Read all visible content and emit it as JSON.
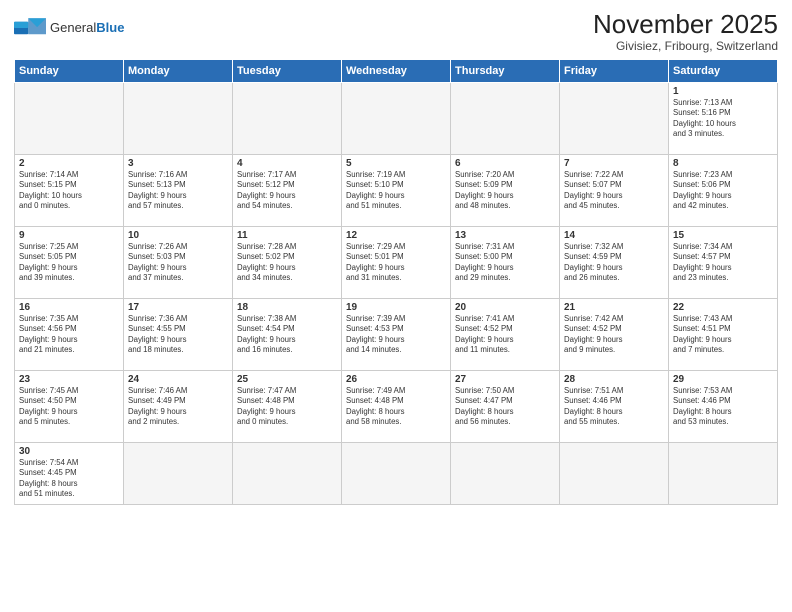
{
  "header": {
    "logo_general": "General",
    "logo_blue": "Blue",
    "month_year": "November 2025",
    "location": "Givisiez, Fribourg, Switzerland"
  },
  "days_of_week": [
    "Sunday",
    "Monday",
    "Tuesday",
    "Wednesday",
    "Thursday",
    "Friday",
    "Saturday"
  ],
  "weeks": [
    [
      {
        "day": "",
        "info": "",
        "empty": true
      },
      {
        "day": "",
        "info": "",
        "empty": true
      },
      {
        "day": "",
        "info": "",
        "empty": true
      },
      {
        "day": "",
        "info": "",
        "empty": true
      },
      {
        "day": "",
        "info": "",
        "empty": true
      },
      {
        "day": "",
        "info": "",
        "empty": true
      },
      {
        "day": "1",
        "info": "Sunrise: 7:13 AM\nSunset: 5:16 PM\nDaylight: 10 hours\nand 3 minutes.",
        "empty": false
      }
    ],
    [
      {
        "day": "2",
        "info": "Sunrise: 7:14 AM\nSunset: 5:15 PM\nDaylight: 10 hours\nand 0 minutes.",
        "empty": false
      },
      {
        "day": "3",
        "info": "Sunrise: 7:16 AM\nSunset: 5:13 PM\nDaylight: 9 hours\nand 57 minutes.",
        "empty": false
      },
      {
        "day": "4",
        "info": "Sunrise: 7:17 AM\nSunset: 5:12 PM\nDaylight: 9 hours\nand 54 minutes.",
        "empty": false
      },
      {
        "day": "5",
        "info": "Sunrise: 7:19 AM\nSunset: 5:10 PM\nDaylight: 9 hours\nand 51 minutes.",
        "empty": false
      },
      {
        "day": "6",
        "info": "Sunrise: 7:20 AM\nSunset: 5:09 PM\nDaylight: 9 hours\nand 48 minutes.",
        "empty": false
      },
      {
        "day": "7",
        "info": "Sunrise: 7:22 AM\nSunset: 5:07 PM\nDaylight: 9 hours\nand 45 minutes.",
        "empty": false
      },
      {
        "day": "8",
        "info": "Sunrise: 7:23 AM\nSunset: 5:06 PM\nDaylight: 9 hours\nand 42 minutes.",
        "empty": false
      }
    ],
    [
      {
        "day": "9",
        "info": "Sunrise: 7:25 AM\nSunset: 5:05 PM\nDaylight: 9 hours\nand 39 minutes.",
        "empty": false
      },
      {
        "day": "10",
        "info": "Sunrise: 7:26 AM\nSunset: 5:03 PM\nDaylight: 9 hours\nand 37 minutes.",
        "empty": false
      },
      {
        "day": "11",
        "info": "Sunrise: 7:28 AM\nSunset: 5:02 PM\nDaylight: 9 hours\nand 34 minutes.",
        "empty": false
      },
      {
        "day": "12",
        "info": "Sunrise: 7:29 AM\nSunset: 5:01 PM\nDaylight: 9 hours\nand 31 minutes.",
        "empty": false
      },
      {
        "day": "13",
        "info": "Sunrise: 7:31 AM\nSunset: 5:00 PM\nDaylight: 9 hours\nand 29 minutes.",
        "empty": false
      },
      {
        "day": "14",
        "info": "Sunrise: 7:32 AM\nSunset: 4:59 PM\nDaylight: 9 hours\nand 26 minutes.",
        "empty": false
      },
      {
        "day": "15",
        "info": "Sunrise: 7:34 AM\nSunset: 4:57 PM\nDaylight: 9 hours\nand 23 minutes.",
        "empty": false
      }
    ],
    [
      {
        "day": "16",
        "info": "Sunrise: 7:35 AM\nSunset: 4:56 PM\nDaylight: 9 hours\nand 21 minutes.",
        "empty": false
      },
      {
        "day": "17",
        "info": "Sunrise: 7:36 AM\nSunset: 4:55 PM\nDaylight: 9 hours\nand 18 minutes.",
        "empty": false
      },
      {
        "day": "18",
        "info": "Sunrise: 7:38 AM\nSunset: 4:54 PM\nDaylight: 9 hours\nand 16 minutes.",
        "empty": false
      },
      {
        "day": "19",
        "info": "Sunrise: 7:39 AM\nSunset: 4:53 PM\nDaylight: 9 hours\nand 14 minutes.",
        "empty": false
      },
      {
        "day": "20",
        "info": "Sunrise: 7:41 AM\nSunset: 4:52 PM\nDaylight: 9 hours\nand 11 minutes.",
        "empty": false
      },
      {
        "day": "21",
        "info": "Sunrise: 7:42 AM\nSunset: 4:52 PM\nDaylight: 9 hours\nand 9 minutes.",
        "empty": false
      },
      {
        "day": "22",
        "info": "Sunrise: 7:43 AM\nSunset: 4:51 PM\nDaylight: 9 hours\nand 7 minutes.",
        "empty": false
      }
    ],
    [
      {
        "day": "23",
        "info": "Sunrise: 7:45 AM\nSunset: 4:50 PM\nDaylight: 9 hours\nand 5 minutes.",
        "empty": false
      },
      {
        "day": "24",
        "info": "Sunrise: 7:46 AM\nSunset: 4:49 PM\nDaylight: 9 hours\nand 2 minutes.",
        "empty": false
      },
      {
        "day": "25",
        "info": "Sunrise: 7:47 AM\nSunset: 4:48 PM\nDaylight: 9 hours\nand 0 minutes.",
        "empty": false
      },
      {
        "day": "26",
        "info": "Sunrise: 7:49 AM\nSunset: 4:48 PM\nDaylight: 8 hours\nand 58 minutes.",
        "empty": false
      },
      {
        "day": "27",
        "info": "Sunrise: 7:50 AM\nSunset: 4:47 PM\nDaylight: 8 hours\nand 56 minutes.",
        "empty": false
      },
      {
        "day": "28",
        "info": "Sunrise: 7:51 AM\nSunset: 4:46 PM\nDaylight: 8 hours\nand 55 minutes.",
        "empty": false
      },
      {
        "day": "29",
        "info": "Sunrise: 7:53 AM\nSunset: 4:46 PM\nDaylight: 8 hours\nand 53 minutes.",
        "empty": false
      }
    ],
    [
      {
        "day": "30",
        "info": "Sunrise: 7:54 AM\nSunset: 4:45 PM\nDaylight: 8 hours\nand 51 minutes.",
        "empty": false
      },
      {
        "day": "",
        "info": "",
        "empty": true
      },
      {
        "day": "",
        "info": "",
        "empty": true
      },
      {
        "day": "",
        "info": "",
        "empty": true
      },
      {
        "day": "",
        "info": "",
        "empty": true
      },
      {
        "day": "",
        "info": "",
        "empty": true
      },
      {
        "day": "",
        "info": "",
        "empty": true
      }
    ]
  ]
}
